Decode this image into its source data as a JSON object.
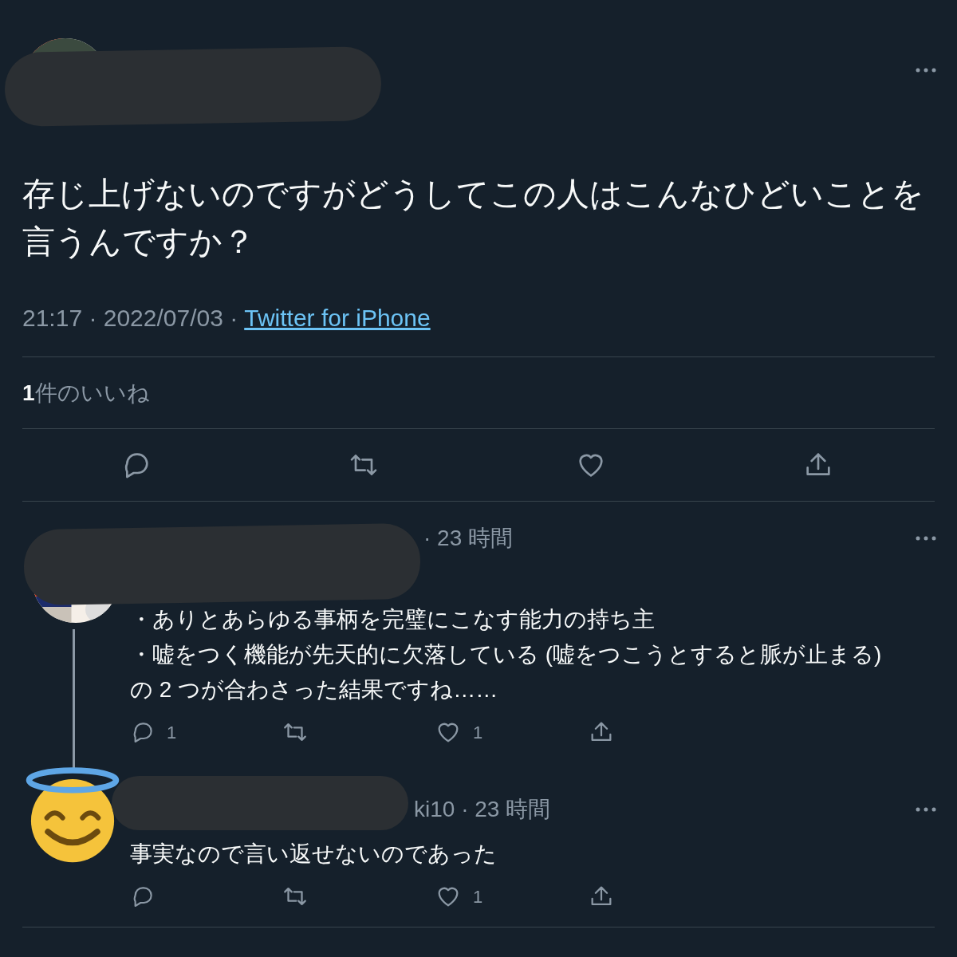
{
  "tweet": {
    "text": "存じ上げないのですがどうしてこの人はこんなひどいことを言うんですか？",
    "timestamp": "21:17 · 2022/07/03 ·",
    "source": "Twitter for iPhone",
    "likes": "**1**件のいいね"
  },
  "replies": [
    {
      "meta": "· 23 時間",
      "lines": [
        "・ありとあらゆる事柄を完璧にこなす能力の持ち主",
        "・嘘をつく機能が先天的に欠落している (嘘をつこうとすると脈が止まる)",
        "の 2 つが合わさった結果ですね……"
      ],
      "reply_count": "1",
      "like_count": "1",
      "thread_line": true
    },
    {
      "avatar": {
        "kind": "emoji"
      },
      "meta": "ki10 · 23 時間",
      "lines": [
        "事実なので言い返せないのであった"
      ],
      "like_count": "1",
      "thread_line": false
    }
  ]
}
